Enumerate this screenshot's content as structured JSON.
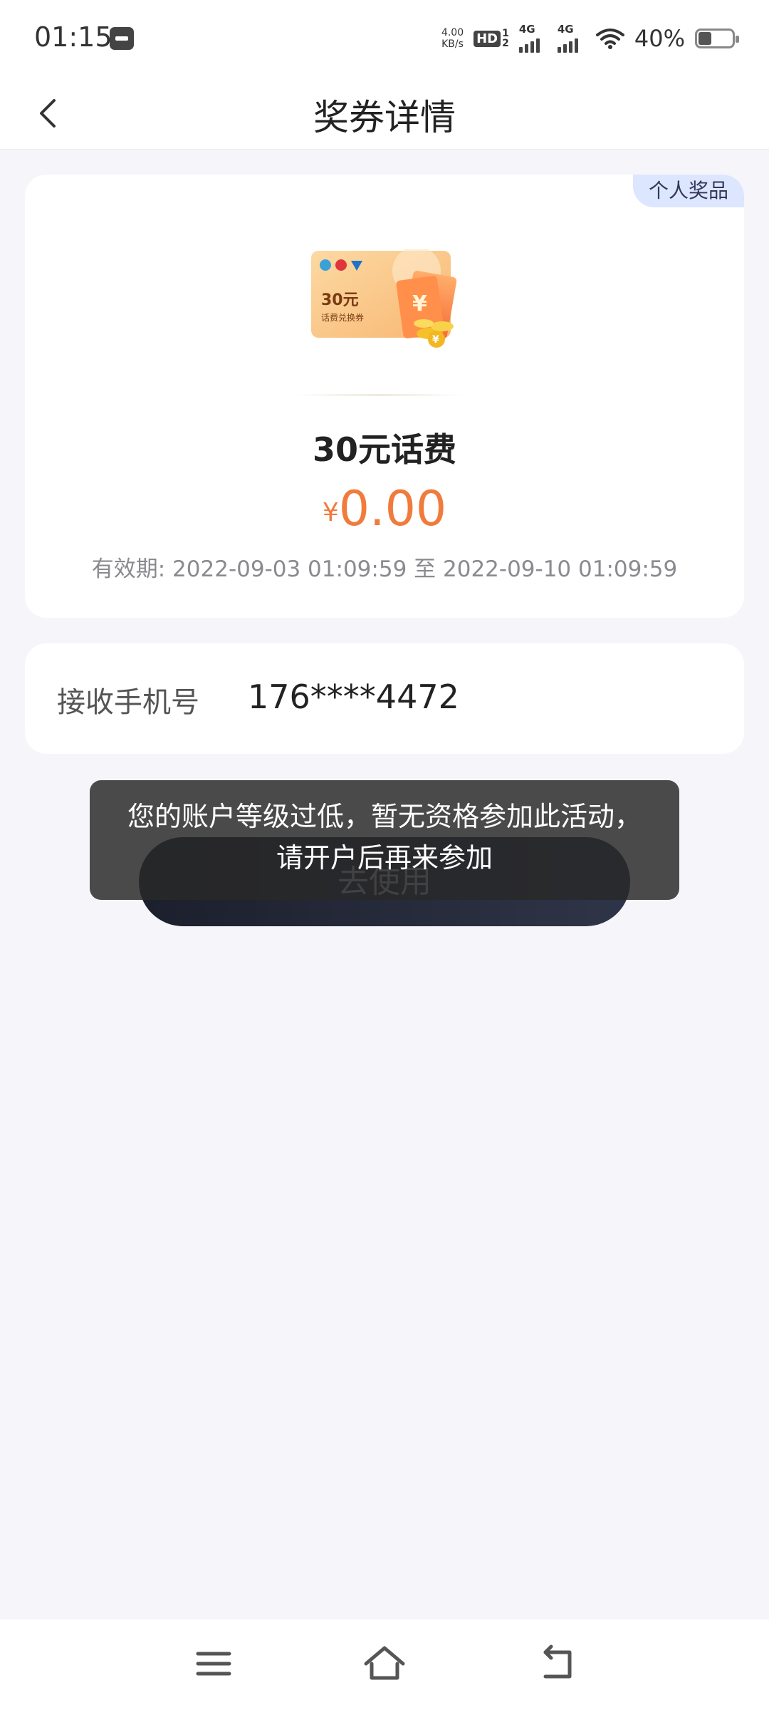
{
  "status_bar": {
    "time": "01:15",
    "net_speed_value": "4.00",
    "net_speed_unit": "KB/s",
    "hd_label": "HD",
    "sim_top": "1",
    "sim_bottom": "2",
    "signal_1_label": "4G",
    "signal_2_label": "4G",
    "battery_percent": "40%",
    "battery_level": 0.4
  },
  "nav": {
    "title": "奖券详情"
  },
  "prize": {
    "tag": "个人奖品",
    "image_amount": "30元",
    "image_caption": "话费兑换券",
    "name": "30元话费",
    "currency": "¥",
    "price": "0.00",
    "validity": "有效期: 2022-09-03 01:09:59 至 2022-09-10 01:09:59"
  },
  "receiver": {
    "label": "接收手机号",
    "phone": "176****4472"
  },
  "actions": {
    "use_label": "去使用"
  },
  "toast": {
    "message": "您的账户等级过低，暂无资格参加此活动，请开户后再来参加"
  },
  "colors": {
    "accent_orange": "#f07b3c",
    "tag_bg": "#dde6ff",
    "button_dark": "#1c1f2c",
    "page_bg": "#f5f5fa"
  },
  "icons": {
    "back": "chevron-left-icon",
    "menu": "menu-icon",
    "home": "home-icon",
    "return": "return-icon"
  }
}
